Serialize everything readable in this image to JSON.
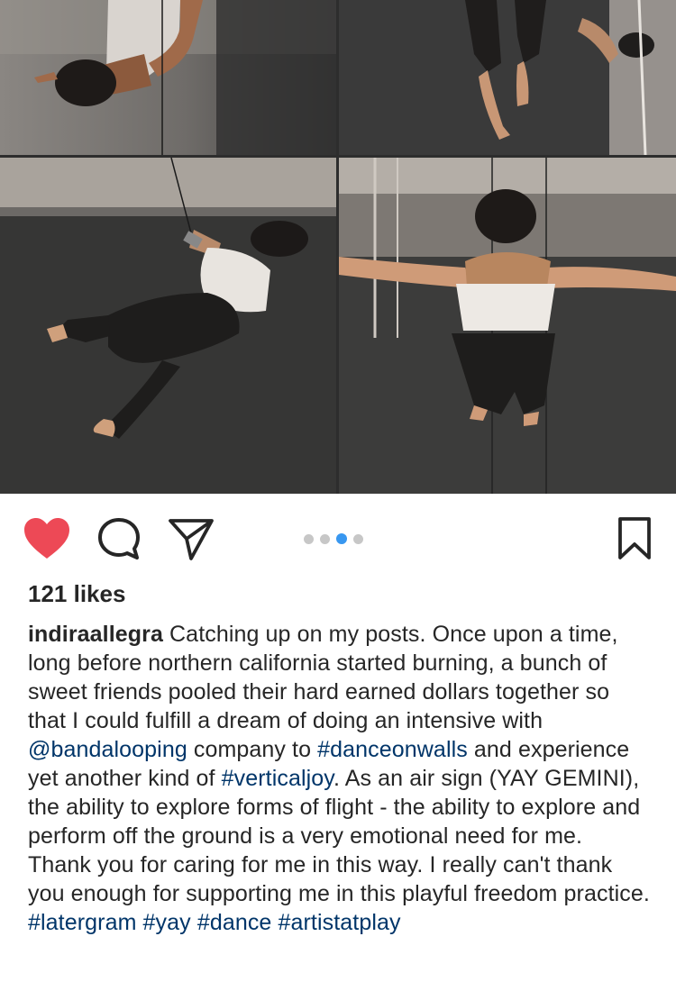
{
  "post": {
    "photos": [
      {
        "name": "aerial dancer upside down on wall, top left"
      },
      {
        "name": "legs of dancer on rope, top right"
      },
      {
        "name": "dancer in harness flying sideways, bottom left"
      },
      {
        "name": "dancer with arms outstretched on wall, bottom right"
      }
    ],
    "carousel": {
      "count": 4,
      "active_index": 2
    },
    "actions": {
      "like_icon": "heart-icon",
      "comment_icon": "comment-icon",
      "share_icon": "paper-plane-icon",
      "save_icon": "bookmark-icon",
      "liked": true,
      "like_color": "#ed4956"
    },
    "likes": "121 likes",
    "caption": {
      "username": "indiraallegra",
      "text_1": " Catching up on my posts. Once upon a time, long before northern california started burning, a bunch of sweet friends pooled their hard earned dollars together so that I could fulfill a dream of doing an intensive with ",
      "mention": "@bandalooping",
      "text_2": " company to ",
      "tag_1": "#danceonwalls",
      "text_3": " and experience yet another kind of ",
      "tag_2": "#verticaljoy",
      "text_4": ". As an air sign (YAY GEMINI), the ability to explore forms of flight - the ability to explore and perform off the ground is a very emotional need for me. Thank you for caring for me in this way. I really can't thank you enough for supporting me in this playful freedom practice. ",
      "tag_3": "#latergram",
      "text_5": " ",
      "tag_4": "#yay",
      "text_6": " ",
      "tag_5": "#dance",
      "text_7": " ",
      "tag_6": "#artistatplay"
    },
    "link_color": "#003569"
  }
}
